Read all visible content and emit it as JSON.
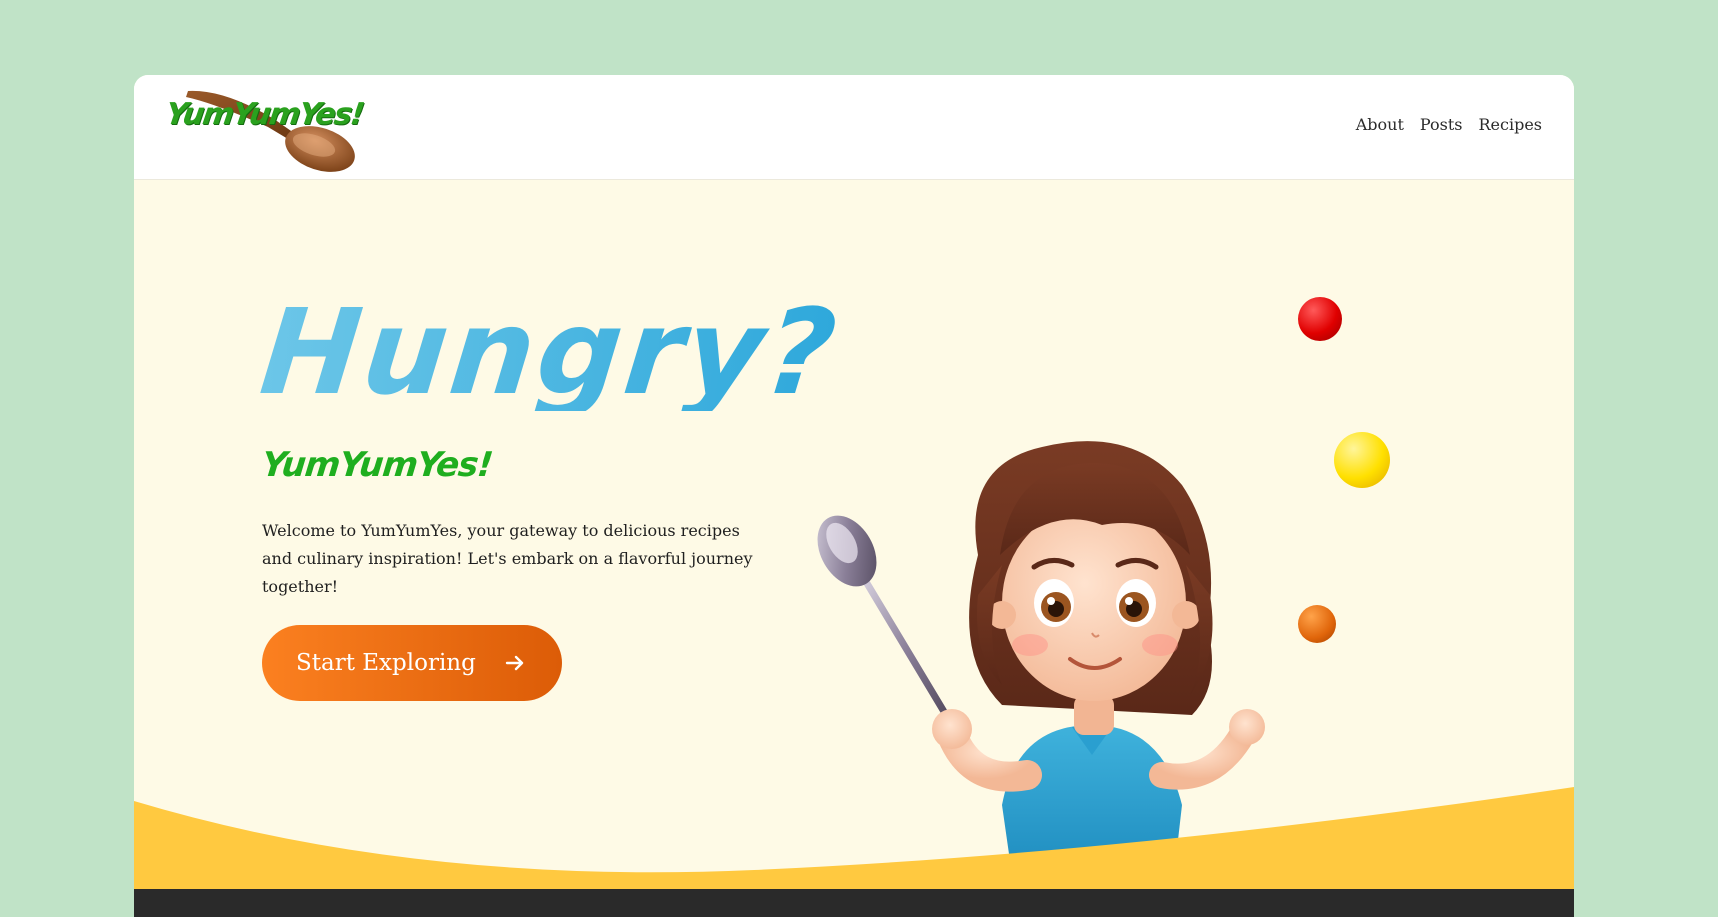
{
  "brand": {
    "logo_text": "YumYumYes!"
  },
  "nav": {
    "items": [
      {
        "label": "About"
      },
      {
        "label": "Posts"
      },
      {
        "label": "Recipes"
      }
    ]
  },
  "hero": {
    "title": "Hungry?",
    "brand_line": "YumYumYes!",
    "description": "Welcome to YumYumYes, your gateway to delicious recipes and culinary inspiration! Let's embark on a flavorful journey together!",
    "cta_label": "Start Exploring"
  },
  "icons": {
    "logo": "wooden-spoon-icon",
    "cta_arrow": "arrow-right-icon",
    "illustration": "girl-holding-spoon-illustration"
  },
  "colors": {
    "background": "#c0e3c7",
    "header": "#ffffff",
    "hero_bg": "#fefae6",
    "title_blue": "#3aabdc",
    "brand_green": "#1fae1f",
    "cta_orange": "#f07214",
    "wave_yellow": "#ffc940",
    "footer": "#2a2a2a"
  }
}
